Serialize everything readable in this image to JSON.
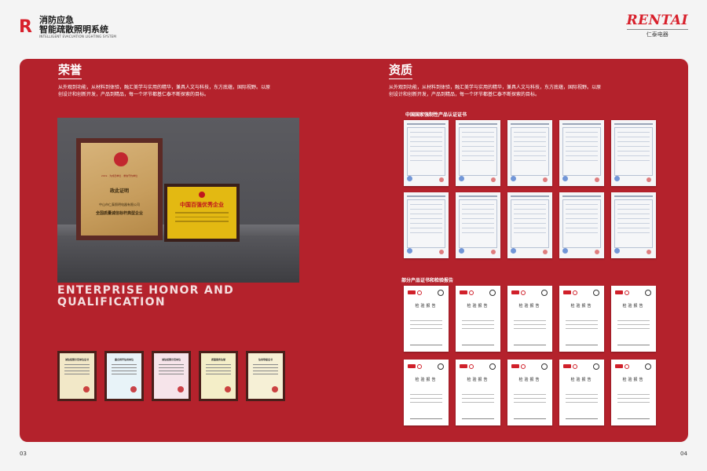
{
  "header": {
    "brand_mark": "R",
    "brand_cn_line1": "消防应急",
    "brand_cn_line2": "智能疏散照明系统",
    "brand_en": "INTELLIGENT EVACUATION LIGHTING SYSTEM",
    "logo_en": "RENTAI",
    "logo_cn": "仁泰电器"
  },
  "left": {
    "title": "荣誉",
    "desc": "从外观到功能，从材料到体验，融汇美学与实用的精华，兼具人文与科技，东方底蕴，国际视野。以原创设计和创新开发，产品到精品，每一个环节都基仁泰不断探索的目标。",
    "plaque_big": {
      "top_line": "2019 · 为成员单位 · 重信守约单位",
      "title": "政此证明",
      "company": "中山市仁泰照明电器有限公司",
      "main": "全国质量诚信标杆典型企业"
    },
    "plaque_small": {
      "title": "中国百强优秀企业"
    },
    "enterprise_line1": "ENTERPRISE HONOR AND",
    "enterprise_line2": "QUALIFICATION",
    "mini_certs": [
      {
        "title": "诚信经营示范单位证书",
        "bg": "#f2e8c8"
      },
      {
        "title": "重合同守信用单位",
        "bg": "#e8f3f8"
      },
      {
        "title": "诚信经营示范单位",
        "bg": "#f6e4ea"
      },
      {
        "title": "质量服务信誉",
        "bg": "#f4eec8"
      },
      {
        "title": "信用等级证书",
        "bg": "#f6f0d6"
      }
    ]
  },
  "right": {
    "title": "资质",
    "desc": "从外观到功能，从材料到体验，融汇美学与实用的精华，兼具人文与科技，东方底蕴，国际视野。以原创设计和创新开发，产品到精品，每一个环节都基仁泰不断探索的目标。",
    "cert_heading": "中国国家强制性产品认证证书",
    "report_heading": "部分产品证书和检验报告",
    "report_title": "检验报告"
  },
  "pages": {
    "left": "03",
    "right": "04"
  }
}
